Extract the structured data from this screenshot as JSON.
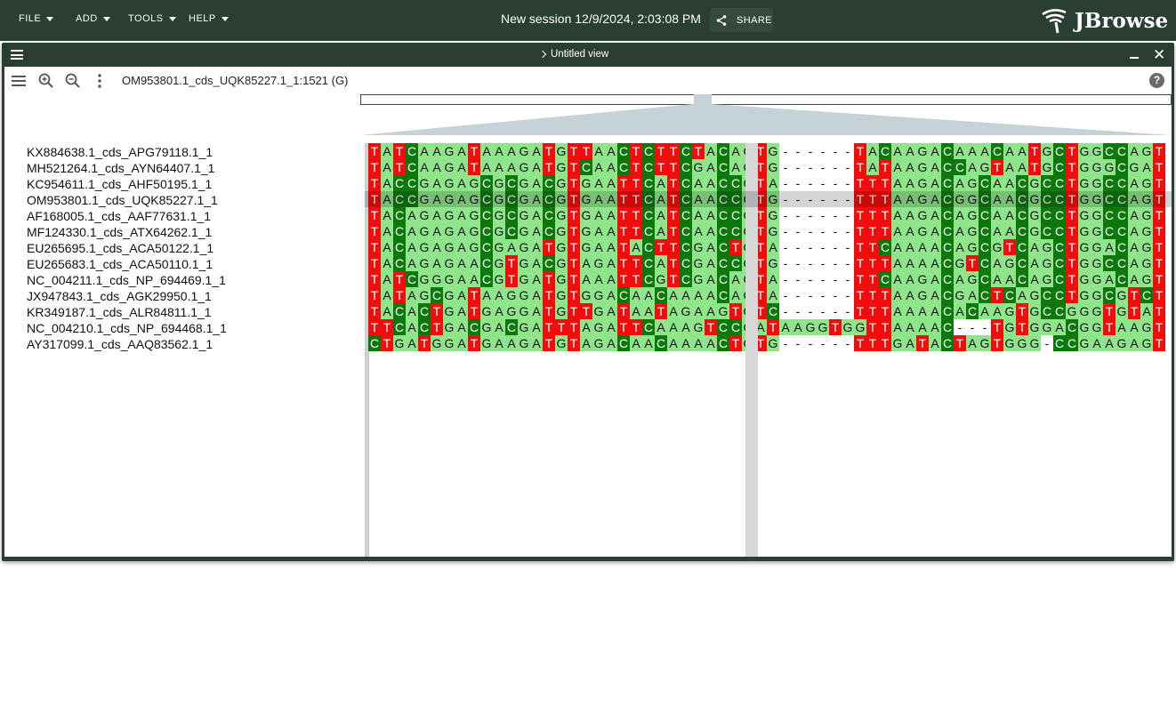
{
  "menu": [
    {
      "label": "FILE"
    },
    {
      "label": "ADD"
    },
    {
      "label": "TOOLS"
    },
    {
      "label": "HELP"
    }
  ],
  "session_title": "New session 12/9/2024, 2:03:08 PM",
  "share_label": "SHARE",
  "logo_text": "JBrowse",
  "view": {
    "title": "Untitled view",
    "locus": "OM953801.1_cds_UQK85227.1_1:1521 (G)",
    "help_label": "?"
  },
  "colors": {
    "appbar": "#2b3e33",
    "T": "#f20c0c",
    "C": "#0a790a",
    "A": "#8fe68a",
    "G": "#8fe68a",
    "gap": "#ffffff"
  },
  "alignment": {
    "names": [
      "KX884638.1_cds_APG79118.1_1",
      "MH521264.1_cds_AYN64407.1_1",
      "KC954611.1_cds_AHF50195.1_1",
      "OM953801.1_cds_UQK85227.1_1",
      "AF168005.1_cds_AAF77631.1_1",
      "MF124330.1_cds_ATX64262.1_1",
      "EU265695.1_cds_ACA50122.1_1",
      "EU265683.1_cds_ACA50110.1_1",
      "NC_004211.1_cds_NP_694469.1_1",
      "JX947843.1_cds_AGK29950.1_1",
      "KR349187.1_cds_ALR84811.1_1",
      "NC_004210.1_cds_NP_694468.1_1",
      "AY317099.1_cds_AAQ83562.1_1"
    ],
    "sequences": [
      "TATCAAGATAAAGATGTTAACTCTTCTACAGTG------TACAAGACAAACAATGCTGGCCAGT",
      "TATCAAGATAAAGATGTCAACTCTTCGACAGTG------TATAAGACCAGTAATGCTGGGCGAT",
      "TACCGAGAGCGCGACGTGAATTCATCAACCGTA------TTTAAGACAGCAACGCCTGGCCAGT",
      "TACCGAGAGCGCGACGTGAATTCATCAACCGTG------TTTAAGACGGCAACGCCTGGCCAGT",
      "TACAGAGAGCGCGACGTGAATTCATCAACCGTG------TTTAAGACAGCAACGCCTGGCCAGT",
      "TACAGAGAGCGCGACGTGAATTCATCAACCGTG------TTTAAGACAGCAACGCCTGGCCAGT",
      "TACAGAGAGCGAGATGTGAATACTTCGACTGTA------TTCAAAACAGCGTCAGCTGGACAGT",
      "TACAGAGAACGTGACGTAGATTCATCGACCGTG------TTTAAAACGTCAGCAGCTGGCCAGT",
      "TATCGGGAACGTGATGTAAATTCGTCGACAGTA------TTCAAGACAGCAACAGCTGGACAGT",
      "TATAGCGATAAGGATGTGGACAACAAAACAGTA------TTTAAGACGACTCAGCCTGGCGTCT",
      "TACACTGATGAGGATGTTGATAATAGAAGTGTC------TTTAAAACACAAGTGCCGGGTGTAT",
      "TTCACTGACGACGATTTAGATTCAAAGTCCGATAAGGTGGTTAAAAC---TGTGGACGGTAAGT",
      "CTGATGGATGAAGATGTAGACAACAAAACTGTG------TTTGATACTAGTGGG-CCGAAGAGT"
    ],
    "highlighted_row": 3
  }
}
